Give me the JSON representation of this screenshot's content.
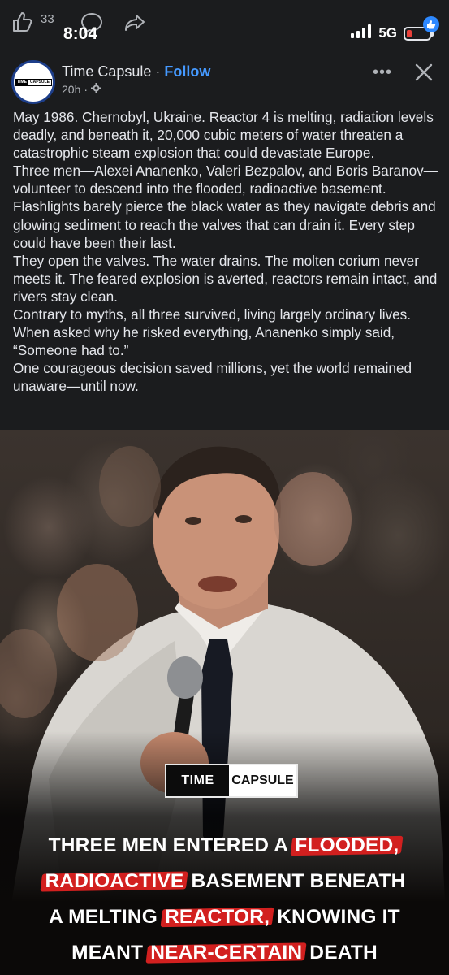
{
  "status_bar": {
    "like_count": "33",
    "time": "8:04",
    "network": "5G",
    "battery_level": 0.22
  },
  "post": {
    "page_name": "Time Capsule",
    "separator": "·",
    "follow_label": "Follow",
    "timestamp": "20h",
    "audience_sep": "·",
    "avatar_logo": {
      "left": "TIME",
      "right": "CAPSULE"
    },
    "paragraphs": [
      "May 1986. Chernobyl, Ukraine. Reactor 4 is melting, radiation levels deadly, and beneath it, 20,000 cubic meters of water threaten a catastrophic steam explosion that could devastate Europe.",
      "Three men—Alexei Ananenko, Valeri Bezpalov, and Boris Baranov—volunteer to descend into the flooded, radioactive basement. Flashlights barely pierce the black water as they navigate debris and glowing sediment to reach the valves that can drain it. Every step could have been their last.",
      "They open the valves. The water drains. The molten corium never meets it. The feared explosion is averted, reactors remain intact, and rivers stay clean.",
      "Contrary to myths, all three survived, living largely ordinary lives. When asked why he risked everything, Ananenko simply said, “Someone had to.”",
      "One courageous decision saved millions, yet the world remained unaware—until now."
    ]
  },
  "image": {
    "logo_left": "TIME",
    "logo_right": "CAPSULE",
    "headline": {
      "l1a": "THREE MEN ENTERED A ",
      "l1b": "FLOODED,",
      "l2a": "RADIOACTIVE",
      "l2b": " BASEMENT BENEATH",
      "l3a": "A MELTING ",
      "l3b": "REACTOR,",
      "l3c": " KNOWING IT",
      "l4a": "MEANT ",
      "l4b": "NEAR-CERTAIN",
      "l4c": " DEATH"
    },
    "highlight_color": "#d2201f"
  },
  "colors": {
    "background": "#1b1c1e",
    "link": "#4599ff",
    "text": "#e4e6eb",
    "muted": "#b0b3b8"
  },
  "icons": [
    "thumbs-up-icon",
    "comment-icon",
    "share-icon",
    "signal-icon",
    "battery-icon",
    "like-badge-icon",
    "globe-gear-icon",
    "more-icon",
    "close-icon"
  ]
}
